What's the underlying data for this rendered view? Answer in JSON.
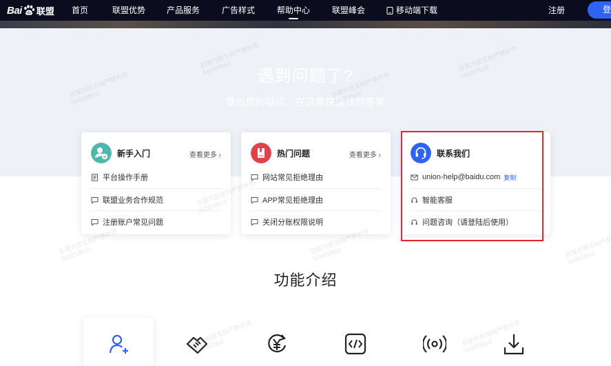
{
  "nav": {
    "logo_text": "Bai",
    "logo_suffix": "联盟",
    "items": [
      "首页",
      "联盟优势",
      "产品服务",
      "广告样式",
      "帮助中心",
      "联盟峰会"
    ],
    "mobile_download": "移动端下载",
    "register": "注册",
    "login": "登"
  },
  "hero": {
    "title": "遇到问题了?",
    "subtitle": "提出您的疑问，在这里快速找到答案"
  },
  "cards": {
    "newbie": {
      "title": "新手入门",
      "more": "查看更多",
      "rows": [
        "平台操作手册",
        "联盟业务合作规范",
        "注册账户常见问题"
      ]
    },
    "hot": {
      "title": "热门问题",
      "more": "查看更多",
      "rows": [
        "网站常见拒绝理由",
        "APP常见拒绝理由",
        "关闭分账权限说明"
      ]
    },
    "contact": {
      "title": "联系我们",
      "email": "union-help@baidu.com",
      "copy": "复制",
      "service": "智能客服",
      "consult": "问题咨询（请登陆后使用）"
    }
  },
  "features": {
    "title": "功能介绍",
    "icons": [
      "add-user-icon",
      "handshake-icon",
      "yen-cycle-icon",
      "code-icon",
      "broadcast-icon",
      "download-icon"
    ]
  },
  "watermark": {
    "line1": "百度内部文档严禁外传",
    "line2": "54985fbcd"
  },
  "colors": {
    "nav_bg": "#0b0d1e",
    "hero_bg": "#eff1f7",
    "accent_blue": "#2e63f6",
    "teal": "#4fb6ad",
    "red": "#e0414b",
    "highlight_border": "#e5232c"
  }
}
